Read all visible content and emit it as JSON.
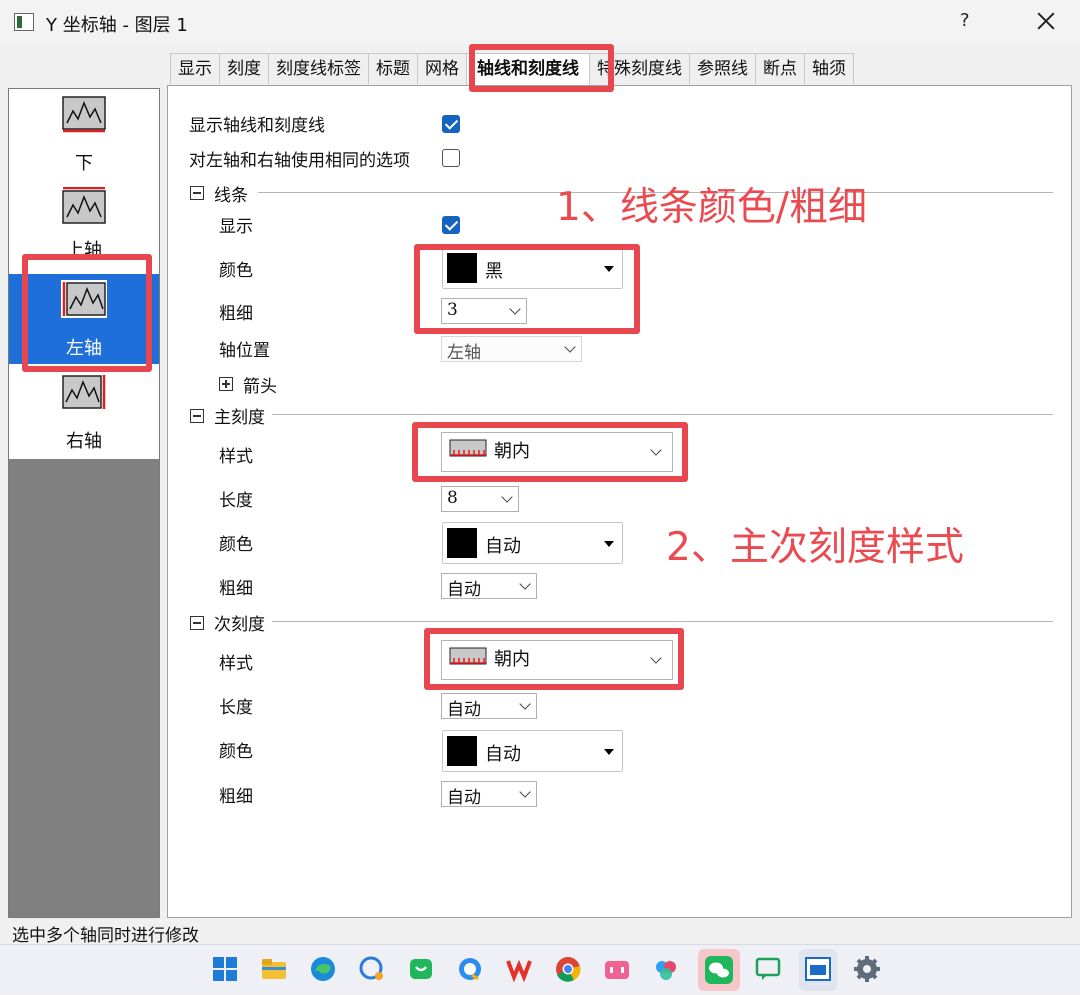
{
  "window": {
    "title": "Y 坐标轴 - 图层 1",
    "help": "?"
  },
  "tabs": [
    {
      "label": "显示"
    },
    {
      "label": "刻度"
    },
    {
      "label": "刻度线标签"
    },
    {
      "label": "标题"
    },
    {
      "label": "网格"
    },
    {
      "label": "轴线和刻度线",
      "active": true
    },
    {
      "label": "特殊刻度线"
    },
    {
      "label": "参照线"
    },
    {
      "label": "断点"
    },
    {
      "label": "轴须"
    }
  ],
  "axes": [
    {
      "label": "下"
    },
    {
      "label": "上轴"
    },
    {
      "label": "左轴",
      "selected": true
    },
    {
      "label": "右轴"
    }
  ],
  "panel": {
    "show_axis_ticks": {
      "label": "显示轴线和刻度线",
      "checked": true
    },
    "same_options": {
      "label": "对左轴和右轴使用相同的选项",
      "checked": false
    },
    "line": {
      "title": "线条",
      "show": {
        "label": "显示",
        "checked": true
      },
      "color": {
        "label": "颜色",
        "value": "黑",
        "swatch": "#000000"
      },
      "thickness": {
        "label": "粗细",
        "value": "3"
      },
      "position": {
        "label": "轴位置",
        "value": "左轴"
      },
      "arrow": {
        "label": "箭头"
      }
    },
    "major": {
      "title": "主刻度",
      "style": {
        "label": "样式",
        "value": "朝内"
      },
      "length": {
        "label": "长度",
        "value": "8"
      },
      "color": {
        "label": "颜色",
        "value": "自动",
        "swatch": "#000000"
      },
      "thickness": {
        "label": "粗细",
        "value": "自动"
      }
    },
    "minor": {
      "title": "次刻度",
      "style": {
        "label": "样式",
        "value": "朝内"
      },
      "length": {
        "label": "长度",
        "value": "自动"
      },
      "color": {
        "label": "颜色",
        "value": "自动",
        "swatch": "#000000"
      },
      "thickness": {
        "label": "粗细",
        "value": "自动"
      }
    }
  },
  "annotations": {
    "a1": "1、线条颜色/粗细",
    "a2": "2、主次刻度样式",
    "color": "#e8474f"
  },
  "status": "选中多个轴同时进行修改",
  "taskbar": [
    {
      "name": "windows-start-icon"
    },
    {
      "name": "file-explorer-icon"
    },
    {
      "name": "edge-icon"
    },
    {
      "name": "chat-icon"
    },
    {
      "name": "messages-icon"
    },
    {
      "name": "qq-browser-icon"
    },
    {
      "name": "wps-icon"
    },
    {
      "name": "chrome-icon"
    },
    {
      "name": "bilibili-icon"
    },
    {
      "name": "baidu-netdisk-icon"
    },
    {
      "name": "wechat-icon"
    },
    {
      "name": "feedback-icon"
    },
    {
      "name": "origin-icon"
    },
    {
      "name": "settings-icon"
    }
  ]
}
